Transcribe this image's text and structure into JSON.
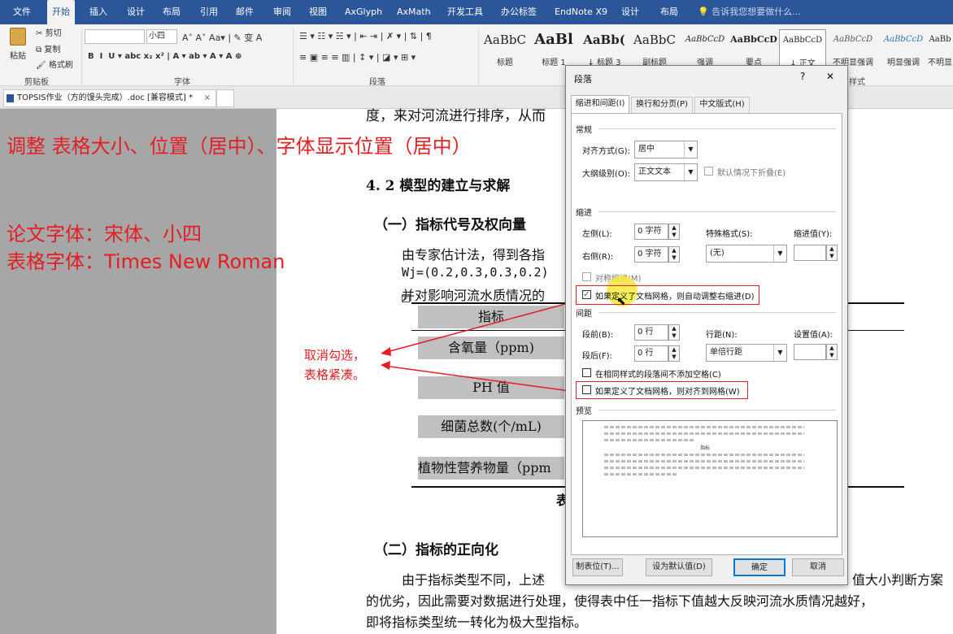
{
  "menubar": {
    "items": [
      "文件",
      "开始",
      "插入",
      "设计",
      "布局",
      "引用",
      "邮件",
      "审阅",
      "视图",
      "AxGlyph",
      "AxMath",
      "开发工具",
      "办公标签",
      "EndNote X9",
      "设计",
      "布局"
    ],
    "search_placeholder": "告诉我您想要做什么..."
  },
  "ribbon": {
    "clipboard": {
      "paste": "粘贴",
      "cut": "剪切",
      "copy": "复制",
      "format_painter": "格式刷",
      "group": "剪贴板"
    },
    "font": {
      "size": "小四",
      "group": "字体"
    },
    "paragraph": {
      "group": "段落"
    },
    "styles": {
      "items": [
        {
          "sample": "AaBbC",
          "name": "标题"
        },
        {
          "sample": "AaBl",
          "name": "标题 1"
        },
        {
          "sample": "AaBb(",
          "name": "↓ 标题 3"
        },
        {
          "sample": "AaBbC",
          "name": "副标题"
        },
        {
          "sample": "AaBbCcD",
          "name": "强调"
        },
        {
          "sample": "AaBbCcD",
          "name": "要点"
        },
        {
          "sample": "AaBbCcD",
          "name": "↓ 正文"
        },
        {
          "sample": "AaBbCcD",
          "name": "不明显强调"
        },
        {
          "sample": "AaBbCcD",
          "name": "明显强调"
        },
        {
          "sample": "AaBb",
          "name": "不明显"
        }
      ],
      "group": "样式"
    }
  },
  "document_tab": {
    "title": "TOPSIS作业（方的馒头完成）.doc [兼容模式] *",
    "close": "×"
  },
  "annotations": {
    "title": "调整 表格大小、位置（居中）、字体显示位置（居中）",
    "paper_font": "论文字体：宋体、小四",
    "table_font": "表格字体：Times New Roman",
    "arrow_note_1": "取消勾选，",
    "arrow_note_2": "表格紧凑。"
  },
  "doc": {
    "line1": "度，来对河流进行排序，从而",
    "heading_42": "4. 2 模型的建立与求解",
    "heading_1": "（一）指标代号及权向量",
    "para1": "由专家估计法，得到各指",
    "weights": "Wj=(0.2,0.3,0.3,0.2)",
    "para2": "并对影响河流水质情况的",
    "table_cells": [
      "指标",
      "含氧量（ppm)",
      "PH 值",
      "细菌总数(个/mL)",
      "植物性营养物量（ppm"
    ],
    "table_caption": "表",
    "heading_2": "（二）指标的正向化",
    "para3a": "由于指标类型不同，上述",
    "para3b": "值大小判断方案",
    "para4": "的优劣，因此需要对数据进行处理，使得表中任一指标下值越大反映河流水质情况越好，",
    "para5": "即将指标类型统一转化为极大型指标。"
  },
  "dialog": {
    "title": "段落",
    "help": "?",
    "close": "✕",
    "tabs": [
      "缩进和间距(I)",
      "换行和分页(P)",
      "中文版式(H)"
    ],
    "general": {
      "section": "常规",
      "align_label": "对齐方式(G):",
      "align_value": "居中",
      "outline_label": "大纲级别(O):",
      "outline_value": "正文文本",
      "collapse_label": "默认情况下折叠(E)"
    },
    "indent": {
      "section": "缩进",
      "left_label": "左侧(L):",
      "left_value": "0 字符",
      "right_label": "右侧(R):",
      "right_value": "0 字符",
      "special_label": "特殊格式(S):",
      "special_value": "(无)",
      "by_label": "缩进值(Y):",
      "mirror_label": "对称缩进(M)",
      "grid_label": "如果定义了文档网格，则自动调整右缩进(D)"
    },
    "spacing": {
      "section": "间距",
      "before_label": "段前(B):",
      "before_value": "0 行",
      "after_label": "段后(F):",
      "after_value": "0 行",
      "line_label": "行距(N):",
      "line_value": "单倍行距",
      "at_label": "设置值(A):",
      "same_style_label": "在相同样式的段落间不添加空格(C)",
      "snap_label": "如果定义了文档网格，则对齐到网格(W)"
    },
    "preview": {
      "section": "预览",
      "sample": "指标"
    },
    "buttons": {
      "tabs": "制表位(T)...",
      "default": "设为默认值(D)",
      "ok": "确定",
      "cancel": "取消"
    }
  }
}
